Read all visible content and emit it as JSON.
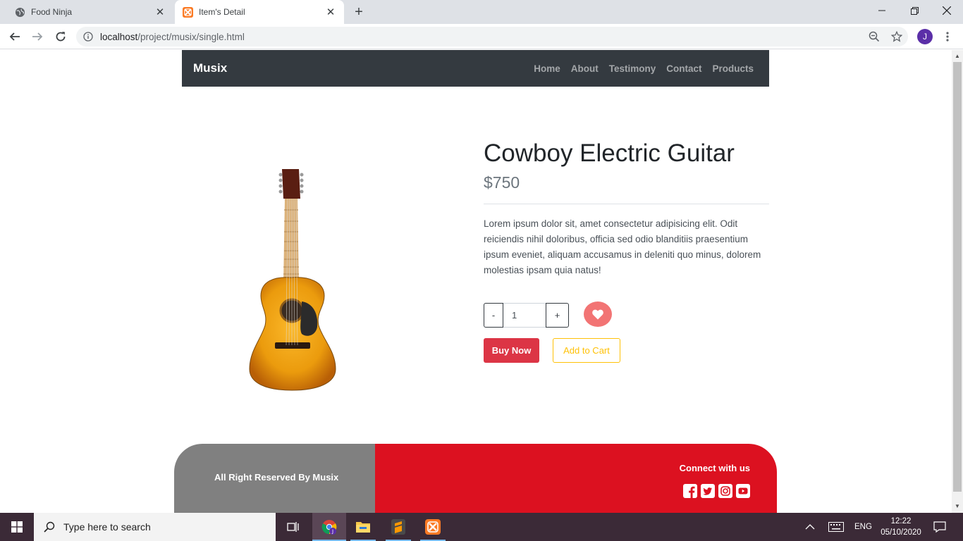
{
  "browser": {
    "tabs": [
      {
        "title": "Food Ninja",
        "active": false
      },
      {
        "title": "Item's Detail",
        "active": true
      }
    ],
    "url_host": "localhost",
    "url_path": "/project/musix/single.html",
    "profile_initial": "J"
  },
  "navbar": {
    "brand": "Musix",
    "links": [
      "Home",
      "About",
      "Testimony",
      "Contact",
      "Products"
    ]
  },
  "product": {
    "title": "Cowboy Electric Guitar",
    "price": "$750",
    "description": "Lorem ipsum dolor sit, amet consectetur adipisicing elit. Odit reiciendis nihil doloribus, officia sed odio blanditiis praesentium ipsum eveniet, aliquam accusamus in deleniti quo minus, dolorem molestias ipsam quia natus!",
    "quantity": "1",
    "minus_label": "-",
    "plus_label": "+",
    "buy_label": "Buy Now",
    "cart_label": "Add to Cart"
  },
  "footer": {
    "rights": "All Right Reserved By Musix",
    "connect": "Connect with us",
    "socials": [
      "facebook-icon",
      "twitter-icon",
      "instagram-icon",
      "youtube-icon"
    ]
  },
  "taskbar": {
    "search_placeholder": "Type here to search",
    "language": "ENG",
    "time": "12:22",
    "date": "05/10/2020"
  },
  "colors": {
    "navbar": "#343a40",
    "buy": "#dc3545",
    "cart": "#ffc107",
    "wishlist": "#f27474",
    "footer_left": "#808080",
    "footer_right": "#dc1120"
  }
}
